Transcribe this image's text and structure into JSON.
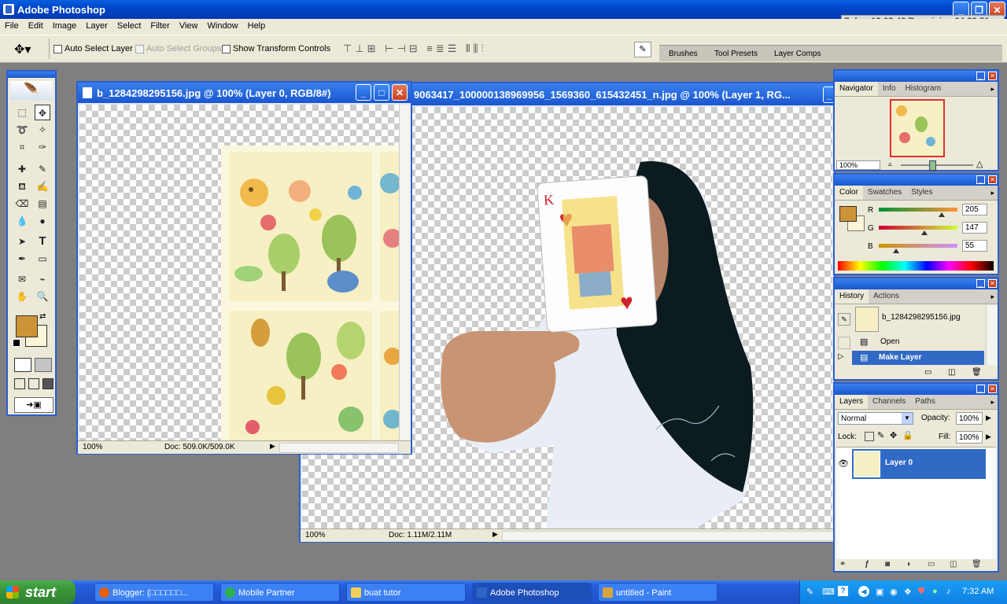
{
  "app": {
    "title": "Adobe Photoshop"
  },
  "timer": {
    "text": "Zuhr : 12:02:43  Remaining 04:29:51"
  },
  "menu": [
    "File",
    "Edit",
    "Image",
    "Layer",
    "Select",
    "Filter",
    "View",
    "Window",
    "Help"
  ],
  "options": {
    "auto_select_layer": "Auto Select Layer",
    "auto_select_groups": "Auto Select Groups",
    "show_transform": "Show Transform Controls"
  },
  "palette_well": {
    "tabs": [
      "Brushes",
      "Tool Presets",
      "Layer Comps"
    ]
  },
  "doc1": {
    "title": "b_1284298295156.jpg @ 100% (Layer 0, RGB/8#)",
    "zoom": "100%",
    "doc_size": "Doc: 509.0K/509.0K"
  },
  "doc2": {
    "title": "9063417_100000138969956_1569360_615432451_n.jpg @ 100% (Layer 1, RG...",
    "zoom": "100%",
    "doc_size": "Doc: 1.11M/2.11M"
  },
  "navigator": {
    "tabs": [
      "Navigator",
      "Info",
      "Histogram"
    ],
    "zoom": "100%"
  },
  "color_panel": {
    "tabs": [
      "Color",
      "Swatches",
      "Styles"
    ],
    "r_label": "R",
    "g_label": "G",
    "b_label": "B",
    "r": "205",
    "g": "147",
    "b": "55",
    "r_level": 0.8,
    "g_level": 0.58,
    "b_level": 0.22,
    "foreground": "#cd9337",
    "background": "#fbf6d8"
  },
  "history": {
    "tabs": [
      "History",
      "Actions"
    ],
    "snapshot": "b_1284298295156.jpg",
    "items": [
      "Open",
      "Make Layer"
    ]
  },
  "layers": {
    "tabs": [
      "Layers",
      "Channels",
      "Paths"
    ],
    "blend_mode": "Normal",
    "opacity_label": "Opacity:",
    "opacity": "100%",
    "lock_label": "Lock:",
    "fill_label": "Fill:",
    "fill": "100%",
    "layer_name": "Layer 0"
  },
  "taskbar": {
    "start": "start",
    "items": [
      "Blogger: (□□□□□□...",
      "Mobile Partner",
      "buat tutor",
      "Adobe Photoshop",
      "untitled - Paint"
    ],
    "clock": "7:32 AM"
  },
  "colors": {
    "xp_blue": "#0047c9",
    "selection": "#316ac5",
    "taskbar": "#245edb",
    "start": "#3c9a3c"
  }
}
